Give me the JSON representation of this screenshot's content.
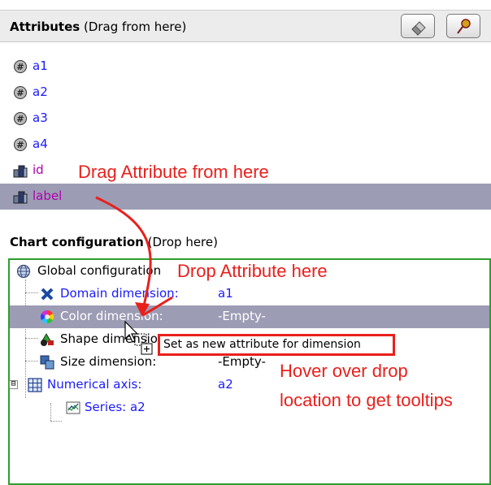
{
  "attributes_panel": {
    "title_bold": "Attributes",
    "title_hint": "(Drag from here)",
    "buttons": [
      {
        "icon": "eraser-icon"
      },
      {
        "icon": "pin-icon"
      }
    ],
    "items": [
      {
        "label": "a1",
        "icon": "numeric-attribute-icon",
        "color": "#1a1aff"
      },
      {
        "label": "a2",
        "icon": "numeric-attribute-icon",
        "color": "#1a1aff"
      },
      {
        "label": "a3",
        "icon": "numeric-attribute-icon",
        "color": "#1a1aff"
      },
      {
        "label": "a4",
        "icon": "numeric-attribute-icon",
        "color": "#1a1aff"
      },
      {
        "label": "id",
        "icon": "nominal-attribute-icon",
        "color": "#b000b0"
      },
      {
        "label": "label",
        "icon": "nominal-attribute-icon",
        "color": "#b000b0",
        "selected": true
      }
    ]
  },
  "chart_configuration": {
    "title_bold": "Chart configuration",
    "title_hint": "(Drop here)",
    "tree": [
      {
        "name": "Global configuration",
        "value": "",
        "icon": "globe-icon"
      },
      {
        "name": "Domain dimension:",
        "value": "a1",
        "icon": "domain-x-icon"
      },
      {
        "name": "Color dimension:",
        "value": "-Empty-",
        "icon": "color-wheel-icon",
        "selected": true
      },
      {
        "name": "Shape dimension:",
        "value": "",
        "icon": "shapes-icon"
      },
      {
        "name": "Size dimension:",
        "value": "-Empty-",
        "icon": "size-icon"
      },
      {
        "name": "Numerical axis:",
        "value": "a2",
        "icon": "grid-axis-icon",
        "expander": "⊟"
      },
      {
        "name": "Series: a2",
        "value": "",
        "icon": "series-chart-icon"
      }
    ]
  },
  "tooltip": {
    "text": "Set as new attribute for dimension"
  },
  "annotations": {
    "drag": "Drag Attribute from here",
    "drop": "Drop Attribute here",
    "hover_line1": "Hover over drop",
    "hover_line2": "location to get tooltips"
  },
  "colors": {
    "selection": "#9c9cb4",
    "annotation": "#e8201c",
    "panel_border": "#2e9e2e",
    "blue_text": "#1a1aff",
    "magenta_text": "#b000b0"
  }
}
